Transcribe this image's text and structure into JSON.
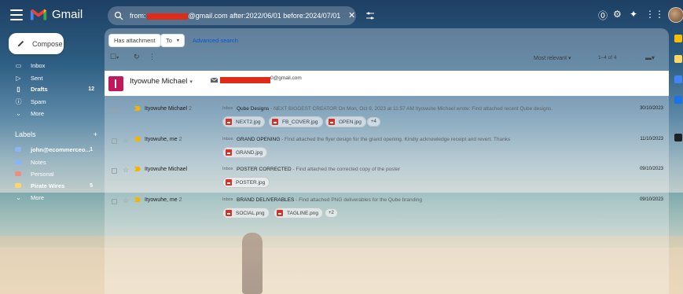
{
  "app": {
    "name": "Gmail"
  },
  "search": {
    "prefix": "from:",
    "suffix": "@gmail.com after:2022/06/01 before:2024/07/01",
    "clear_glyph": "✕"
  },
  "header_icons": [
    "help-icon",
    "settings-icon",
    "gemini-icon",
    "apps-icon"
  ],
  "sidebar": {
    "compose_label": "Compose",
    "items": [
      {
        "label": "Inbox",
        "icon": "inbox-icon",
        "count": ""
      },
      {
        "label": "Sent",
        "icon": "sent-icon",
        "count": ""
      },
      {
        "label": "Drafts",
        "icon": "draft-icon",
        "count": "12"
      },
      {
        "label": "Spam",
        "icon": "spam-icon",
        "count": ""
      },
      {
        "label": "More",
        "icon": "chevron-down-icon",
        "count": ""
      }
    ],
    "labels_title": "Labels",
    "labels_add": "+",
    "labels": [
      {
        "label": "john@ecommerceo...",
        "count": "1",
        "color": "#8ab4f8"
      },
      {
        "label": "Notes",
        "count": "",
        "color": "#8ab4f8"
      },
      {
        "label": "Personal",
        "count": "",
        "color": "#f28b82"
      },
      {
        "label": "Pirate Wires",
        "count": "5",
        "color": "#fdd663"
      }
    ],
    "labels_more": "More"
  },
  "filters": {
    "has_attachment": "Has attachment",
    "to": "To",
    "advanced_search": "Advanced search"
  },
  "toolbar": {
    "sort": "Most relevant",
    "range": "1–4 of 4"
  },
  "person": {
    "name": "Ityowuhe Michael",
    "email_suffix": "0@gmail.com"
  },
  "emails": [
    {
      "sender": "Ityowuhe Michael",
      "count": "2",
      "tag": "Inbox",
      "subject": "Qube Designs",
      "snippet": " - NEXT BIGGEST CREATOR On Mon, Oct 9, 2023 at 11:57 AM Ityowuhe Michael wrote: Find attached recent Qube designs.",
      "date": "30/10/2023",
      "attachments": [
        "NEXT2.jpg",
        "FB_COVER.jpg",
        "OPEN.jpg"
      ],
      "more": "+4"
    },
    {
      "sender": "Ityowuhe, me",
      "count": "2",
      "tag": "Inbox",
      "subject": "GRAND OPENING",
      "snippet": " - Find attached the flyer design for the grand opening. Kindly acknowledge receipt and revert. Thanks",
      "date": "11/10/2023",
      "attachments": [
        "GRAND.jpg"
      ],
      "more": ""
    },
    {
      "sender": "Ityowuhe Michael",
      "count": "",
      "tag": "Inbox",
      "subject": "POSTER CORRECTED",
      "snippet": " - Find attached the corrected copy of the poster",
      "date": "09/10/2023",
      "attachments": [
        "POSTER.jpg"
      ],
      "more": ""
    },
    {
      "sender": "Ityowuhe, me",
      "count": "2",
      "tag": "Inbox",
      "subject": "BRAND DELIVERABLES",
      "snippet": " - Find attached PNG deliverables for the Qube branding",
      "date": "09/10/2023",
      "attachments": [
        "SOCIAL.png",
        "TAGLINE.png"
      ],
      "more": "+2"
    }
  ]
}
